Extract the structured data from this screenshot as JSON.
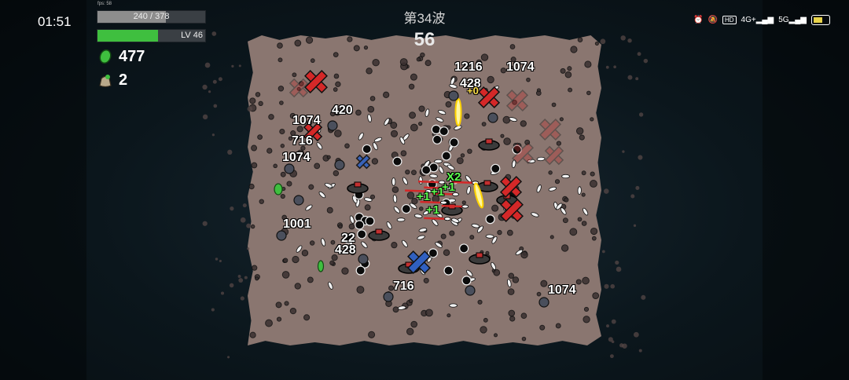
{
  "status_bar": {
    "time": "01:51",
    "icons": [
      "alarm-icon",
      "mute-icon",
      "hd-icon",
      "4g-signal-icon",
      "5g-signal-icon",
      "battery-icon"
    ],
    "net1": "4G+",
    "net2": "5G"
  },
  "hud": {
    "fps": "fps: 58",
    "hp": {
      "text": "240 / 378",
      "current": 240,
      "max": 378
    },
    "xp": {
      "text": "LV 46",
      "fill_fraction": 0.56
    },
    "materials": "477",
    "bags": "2",
    "wave": "第34波",
    "timer": "56"
  },
  "floating_numbers": {
    "n1": "1216",
    "n2": "1074",
    "n3": "428",
    "n4": "420",
    "n5": "1074",
    "n6": "716",
    "n7": "1074",
    "n8": "1001",
    "n9": "22",
    "n10": "428",
    "n11": "716",
    "n12": "1074",
    "combo": "X2",
    "heal1": "+1",
    "heal2": "+1",
    "heal3": "+1",
    "heal4": "+1",
    "bonus": "+0"
  },
  "colors": {
    "arena": "#8a7670",
    "hp_fill": "#8d8d8d",
    "xp_fill": "#3fbf3f",
    "heal_text": "#5dff4f",
    "enemy_cross": "#d42828",
    "ally_cross": "#3060c0"
  }
}
